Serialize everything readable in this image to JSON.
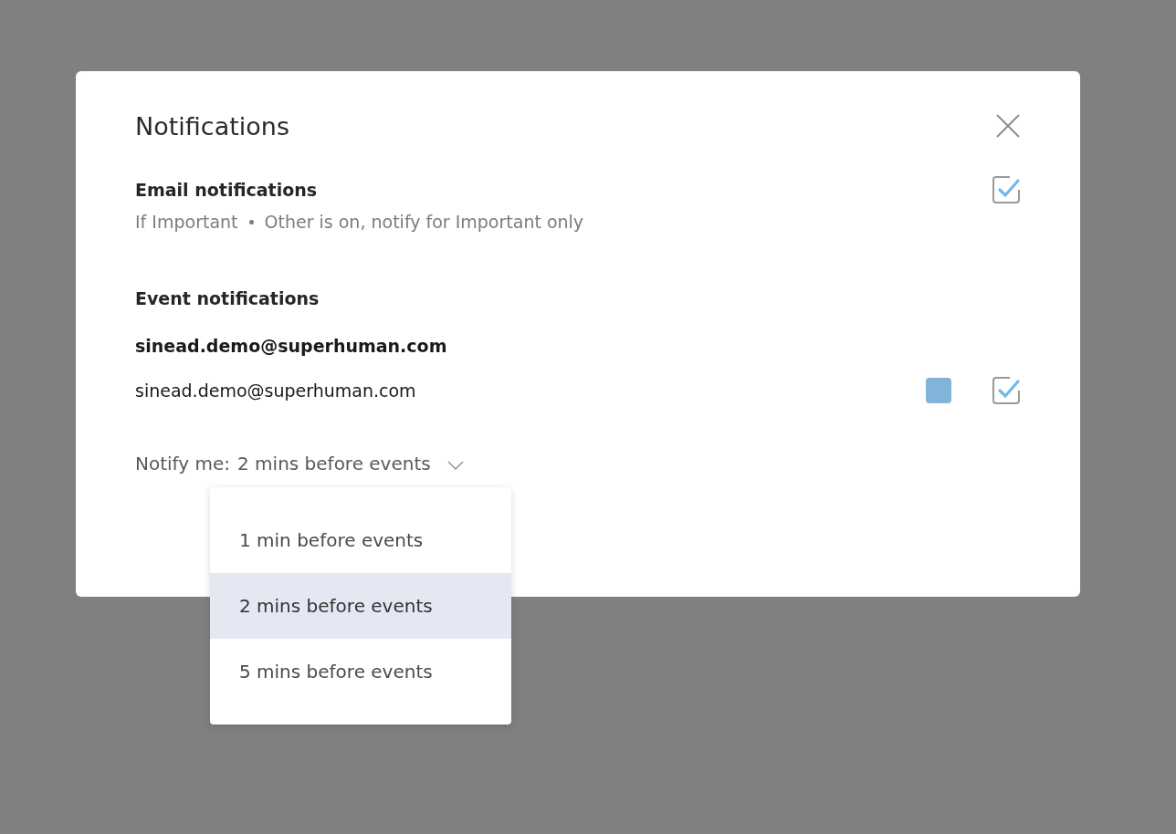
{
  "dialog": {
    "title": "Notifications"
  },
  "email_notifications": {
    "label": "Email notifications",
    "checked": true,
    "description": [
      "If Important",
      "Other is on, notify for Important only"
    ]
  },
  "event_notifications": {
    "label": "Event notifications",
    "account": "sinead.demo@superhuman.com",
    "calendars": [
      {
        "name": "sinead.demo@superhuman.com",
        "color": "#82b4d9",
        "checked": true
      }
    ]
  },
  "notify": {
    "label": "Notify me:",
    "value": "2 mins before events",
    "expanded": true,
    "options": [
      {
        "label": "1 min before events",
        "selected": false
      },
      {
        "label": "2 mins before events",
        "selected": true
      },
      {
        "label": "5 mins before events",
        "selected": false
      }
    ]
  }
}
